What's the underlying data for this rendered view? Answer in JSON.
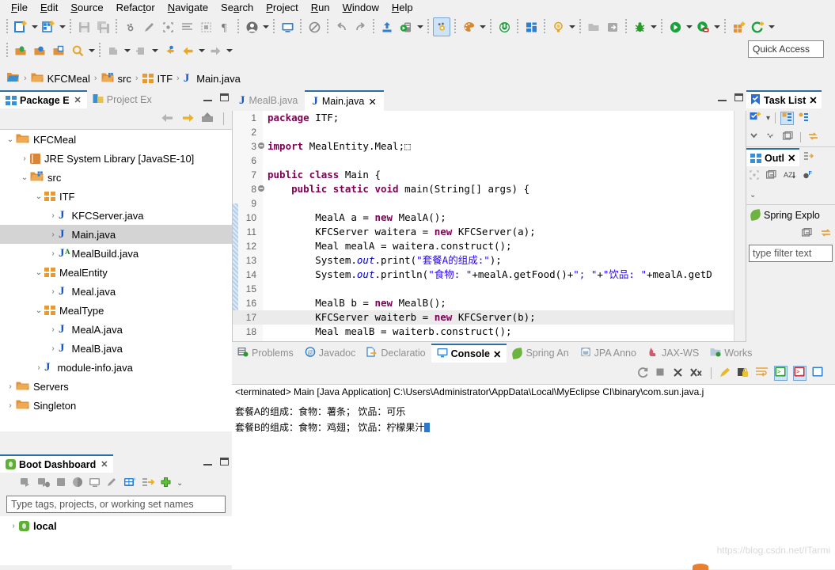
{
  "menu": {
    "items": [
      {
        "label": "File",
        "mnemonic": "F"
      },
      {
        "label": "Edit",
        "mnemonic": "E"
      },
      {
        "label": "Source",
        "mnemonic": "S"
      },
      {
        "label": "Refactor",
        "mnemonic": "t"
      },
      {
        "label": "Navigate",
        "mnemonic": "N"
      },
      {
        "label": "Search",
        "mnemonic": "a"
      },
      {
        "label": "Project",
        "mnemonic": "P"
      },
      {
        "label": "Run",
        "mnemonic": "R"
      },
      {
        "label": "Window",
        "mnemonic": "W"
      },
      {
        "label": "Help",
        "mnemonic": "H"
      }
    ]
  },
  "toolbar": {
    "quick_access_label": "Quick Access",
    "row1_icons": [
      "new-file-icon",
      "new-file-dropdown",
      "new-wizard-icon",
      "new-wizard-dropdown",
      "save-icon",
      "save-all-icon",
      "toggle-breakpoint-icon",
      "edit-icon",
      "focus-icon",
      "format-icon",
      "marker-icon",
      "pilcrow-icon",
      "user-icon",
      "user-dropdown",
      "monitor-icon",
      "no-entry-icon",
      "undo-icon",
      "redo-icon",
      "export-icon",
      "server-icon",
      "server-dropdown",
      "debug-toggle-icon",
      "palette-icon",
      "palette-dropdown",
      "power-icon",
      "perspective-icon",
      "quick-fix-icon",
      "quick-fix-dropdown",
      "open-folder-icon",
      "exit-icon",
      "debug-bug-icon",
      "debug-dropdown",
      "run-icon",
      "run-dropdown",
      "run-stop-icon",
      "run-stop-dropdown",
      "new-module-icon",
      "coverage-icon",
      "coverage-dropdown"
    ],
    "row2_icons": [
      "open-type-icon",
      "open-resource-icon",
      "open-task-icon",
      "search-icon",
      "search-dropdown",
      "next-annotation-icon",
      "next-annotation-dropdown",
      "prev-annotation-icon",
      "prev-annotation-dropdown",
      "back-marked-icon",
      "back-icon",
      "back-dropdown",
      "forward-icon",
      "forward-dropdown"
    ]
  },
  "breadcrumb": {
    "root_icon": "workspace-folder-icon",
    "segments": [
      {
        "label": "KFCMeal",
        "icon": "project-folder-icon"
      },
      {
        "label": "src",
        "icon": "source-folder-icon"
      },
      {
        "label": "ITF",
        "icon": "package-icon"
      },
      {
        "label": "Main.java",
        "icon": "java-file-icon"
      }
    ]
  },
  "left_panel": {
    "tabs": [
      {
        "label": "Package E",
        "active": true,
        "icon": "package-explorer-icon",
        "closable": true
      },
      {
        "label": "Project Ex",
        "active": false,
        "icon": "project-explorer-icon",
        "closable": false
      }
    ],
    "toolbar_icons": [
      "back-arrow-icon",
      "forward-arrow-icon",
      "collapse-up-icon"
    ],
    "tree": [
      {
        "label": "KFCMeal",
        "indent": 0,
        "twist": "v",
        "icon": "project-folder-icon",
        "selected": false
      },
      {
        "label": "JRE System Library [JavaSE-10]",
        "indent": 1,
        "twist": ">",
        "icon": "jre-library-icon",
        "selected": false
      },
      {
        "label": "src",
        "indent": 1,
        "twist": "v",
        "icon": "source-folder-icon",
        "selected": false
      },
      {
        "label": "ITF",
        "indent": 2,
        "twist": "v",
        "icon": "package-icon",
        "selected": false
      },
      {
        "label": "KFCServer.java",
        "indent": 3,
        "twist": ">",
        "icon": "java-file-icon",
        "selected": false
      },
      {
        "label": "Main.java",
        "indent": 3,
        "twist": ">",
        "icon": "java-file-icon",
        "selected": true
      },
      {
        "label": "MealBuild.java",
        "indent": 3,
        "twist": ">",
        "icon": "java-abstract-file-icon",
        "selected": false
      },
      {
        "label": "MealEntity",
        "indent": 2,
        "twist": "v",
        "icon": "package-icon",
        "selected": false
      },
      {
        "label": "Meal.java",
        "indent": 3,
        "twist": ">",
        "icon": "java-file-icon",
        "selected": false
      },
      {
        "label": "MealType",
        "indent": 2,
        "twist": "v",
        "icon": "package-icon",
        "selected": false
      },
      {
        "label": "MealA.java",
        "indent": 3,
        "twist": ">",
        "icon": "java-file-icon",
        "selected": false
      },
      {
        "label": "MealB.java",
        "indent": 3,
        "twist": ">",
        "icon": "java-file-icon",
        "selected": false
      },
      {
        "label": "module-info.java",
        "indent": 2,
        "twist": ">",
        "icon": "java-file-icon",
        "selected": false
      },
      {
        "label": "Servers",
        "indent": 0,
        "twist": ">",
        "icon": "plain-folder-icon",
        "selected": false
      },
      {
        "label": "Singleton",
        "indent": 0,
        "twist": ">",
        "icon": "project-folder-icon",
        "selected": false
      }
    ]
  },
  "boot_dashboard": {
    "tab_label": "Boot Dashboard",
    "tab_icon": "spring-boot-icon",
    "toolbar_icons": [
      "start-icon",
      "debug-start-icon",
      "stop-icon",
      "redeploy-icon",
      "open-console-icon",
      "edit-config-icon",
      "properties-icon",
      "tag-icon",
      "add-icon",
      "menu-chevron-icon"
    ],
    "filter_placeholder": "Type tags, projects, or working set names",
    "tree": [
      {
        "label": "local",
        "twist": ">",
        "icon": "spring-boot-icon"
      }
    ]
  },
  "editor": {
    "tabs": [
      {
        "label": "MealB.java",
        "active": false,
        "icon": "java-file-icon",
        "closable": false
      },
      {
        "label": "Main.java",
        "active": true,
        "icon": "java-file-icon",
        "closable": true
      }
    ],
    "lines": [
      {
        "num": "1",
        "mark": "",
        "hl": false,
        "tokens": [
          {
            "t": "package ",
            "c": "kw"
          },
          {
            "t": "ITF;",
            "c": "plain"
          }
        ]
      },
      {
        "num": "2",
        "mark": "",
        "hl": false,
        "tokens": []
      },
      {
        "num": "3",
        "mark": "folded",
        "hl": false,
        "tokens": [
          {
            "t": "import ",
            "c": "kw"
          },
          {
            "t": "MealEntity.Meal;",
            "c": "plain"
          },
          {
            "t": "⬚",
            "c": "plain"
          }
        ]
      },
      {
        "num": "6",
        "mark": "",
        "hl": false,
        "tokens": []
      },
      {
        "num": "7",
        "mark": "",
        "hl": false,
        "tokens": [
          {
            "t": "public class ",
            "c": "kw"
          },
          {
            "t": "Main {",
            "c": "plain"
          }
        ]
      },
      {
        "num": "8",
        "mark": "override",
        "hl": false,
        "tokens": [
          {
            "t": "    public static void ",
            "c": "kw"
          },
          {
            "t": "main(String[] args) {",
            "c": "plain"
          }
        ]
      },
      {
        "num": "9",
        "mark": "",
        "hl": false,
        "tokens": []
      },
      {
        "num": "10",
        "mark": "",
        "hl": false,
        "tokens": [
          {
            "t": "        MealA a = ",
            "c": "plain"
          },
          {
            "t": "new ",
            "c": "kw"
          },
          {
            "t": "MealA();",
            "c": "plain"
          }
        ]
      },
      {
        "num": "11",
        "mark": "",
        "hl": false,
        "tokens": [
          {
            "t": "        KFCServer waitera = ",
            "c": "plain"
          },
          {
            "t": "new ",
            "c": "kw"
          },
          {
            "t": "KFCServer(a);",
            "c": "plain"
          }
        ]
      },
      {
        "num": "12",
        "mark": "",
        "hl": false,
        "tokens": [
          {
            "t": "        Meal mealA = waitera.construct();",
            "c": "plain"
          }
        ]
      },
      {
        "num": "13",
        "mark": "",
        "hl": false,
        "tokens": [
          {
            "t": "        System.",
            "c": "plain"
          },
          {
            "t": "out",
            "c": "fld"
          },
          {
            "t": ".print(",
            "c": "plain"
          },
          {
            "t": "\"套餐A的组成:\"",
            "c": "str"
          },
          {
            "t": ");",
            "c": "plain"
          }
        ]
      },
      {
        "num": "14",
        "mark": "",
        "hl": false,
        "tokens": [
          {
            "t": "        System.",
            "c": "plain"
          },
          {
            "t": "out",
            "c": "fld"
          },
          {
            "t": ".println(",
            "c": "plain"
          },
          {
            "t": "\"食物: \"",
            "c": "str"
          },
          {
            "t": "+mealA.getFood()+",
            "c": "plain"
          },
          {
            "t": "\"; \"",
            "c": "str"
          },
          {
            "t": "+",
            "c": "plain"
          },
          {
            "t": "\"饮品: \"",
            "c": "str"
          },
          {
            "t": "+mealA.getD",
            "c": "plain"
          }
        ]
      },
      {
        "num": "15",
        "mark": "",
        "hl": false,
        "tokens": []
      },
      {
        "num": "16",
        "mark": "",
        "hl": false,
        "tokens": [
          {
            "t": "        MealB b = ",
            "c": "plain"
          },
          {
            "t": "new ",
            "c": "kw"
          },
          {
            "t": "MealB();",
            "c": "plain"
          }
        ]
      },
      {
        "num": "17",
        "mark": "",
        "hl": true,
        "tokens": [
          {
            "t": "        KFCServer waiterb = ",
            "c": "plain"
          },
          {
            "t": "new ",
            "c": "kw"
          },
          {
            "t": "KFCServer(b);",
            "c": "plain"
          }
        ]
      },
      {
        "num": "18",
        "mark": "",
        "hl": false,
        "tokens": [
          {
            "t": "        Meal mealB = waiterb.construct();",
            "c": "plain"
          }
        ]
      }
    ]
  },
  "bottom_panel": {
    "tabs": [
      {
        "label": "Problems",
        "active": false,
        "icon": "problems-icon",
        "closable": false
      },
      {
        "label": "Javadoc",
        "active": false,
        "icon": "javadoc-icon",
        "closable": false
      },
      {
        "label": "Declaratio",
        "active": false,
        "icon": "declaration-icon",
        "closable": false
      },
      {
        "label": "Console",
        "active": true,
        "icon": "console-icon",
        "closable": true
      },
      {
        "label": "Spring An",
        "active": false,
        "icon": "spring-leaf-icon",
        "closable": false
      },
      {
        "label": "JPA Anno",
        "active": false,
        "icon": "jpa-icon",
        "closable": false
      },
      {
        "label": "JAX-WS",
        "active": false,
        "icon": "jaxws-icon",
        "closable": false
      },
      {
        "label": "Works",
        "active": false,
        "icon": "workspace-icon",
        "closable": false
      }
    ],
    "toolbar_icons": [
      "refresh-icon",
      "terminate-icon",
      "remove-launch-icon",
      "remove-all-launches-icon",
      "clear-console-icon",
      "scroll-lock-icon",
      "word-wrap-icon",
      "display-selected-console-icon",
      "open-console-error-icon",
      "pin-console-icon"
    ],
    "console": {
      "header": "<terminated> Main [Java Application] C:\\Users\\Administrator\\AppData\\Local\\MyEclipse CI\\binary\\com.sun.java.j",
      "lines": [
        "套餐A的组成：食物：薯条；  饮品：可乐",
        "套餐B的组成：食物：鸡翅；  饮品：柠檬果汁"
      ]
    }
  },
  "right_bar": {
    "task_list": {
      "tab_label": "Task List",
      "tab_icon": "task-list-icon",
      "toolbar_icons": [
        "new-task-icon",
        "task-dropdown-icon",
        "categorized-icon",
        "scheduled-icon"
      ],
      "row2_icons": [
        "collapse-all-icon",
        "expand-all-icon",
        "view-menu-icon",
        "sync-icon"
      ]
    },
    "outline": {
      "tab_label": "Outl",
      "tab_icon": "outline-icon",
      "toolbar_icons": [
        "link-editor-icon",
        "focus-icon",
        "collapse-all-icon",
        "sort-icon",
        "hide-fields-icon",
        "view-menu-chevron-icon"
      ]
    },
    "spring_explorer": {
      "tab_label": "Spring Explo",
      "tab_icon": "spring-leaf-icon",
      "toolbar_icons": [
        "collapse-all-icon",
        "link-icon"
      ],
      "filter_placeholder": "type filter text"
    }
  },
  "watermark": "https://blog.csdn.net/ITarmi"
}
